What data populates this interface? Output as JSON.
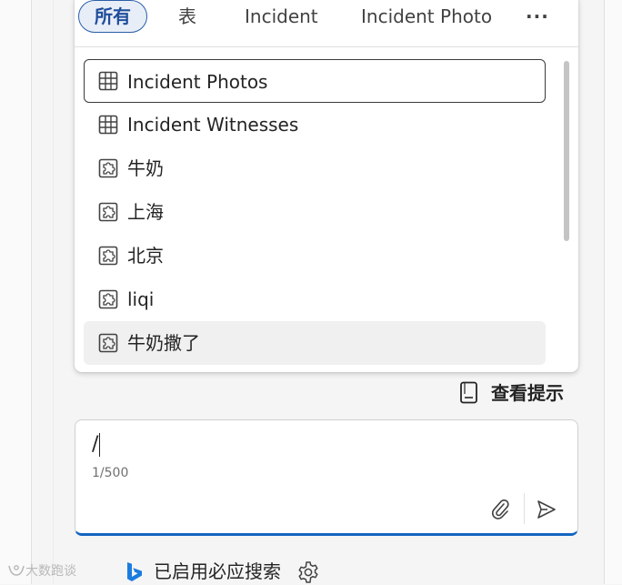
{
  "popup": {
    "tabs": [
      {
        "label": "所有",
        "active": true
      },
      {
        "label": "表"
      },
      {
        "label": "Incident"
      },
      {
        "label": "Incident Photo"
      }
    ],
    "more_label": "···",
    "items": [
      {
        "label": "Incident Photos",
        "icon": "table-icon"
      },
      {
        "label": "Incident Witnesses",
        "icon": "table-icon"
      },
      {
        "label": "牛奶",
        "icon": "puzzle-icon"
      },
      {
        "label": "上海",
        "icon": "puzzle-icon"
      },
      {
        "label": "北京",
        "icon": "puzzle-icon"
      },
      {
        "label": "liqi",
        "icon": "puzzle-icon"
      },
      {
        "label": "牛奶撒了",
        "icon": "puzzle-icon"
      }
    ]
  },
  "view_prompts": {
    "label": "查看提示",
    "icon": "book-icon"
  },
  "input": {
    "value": "/",
    "counter": "1/500"
  },
  "bing": {
    "label": "已启用必应搜索",
    "icon": "bing-icon"
  },
  "watermark": {
    "text": "大数跑谈"
  },
  "colors": {
    "accent": "#1565c0",
    "active_tab_border": "#2b5fa8",
    "active_tab_bg": "#e8eef8"
  }
}
